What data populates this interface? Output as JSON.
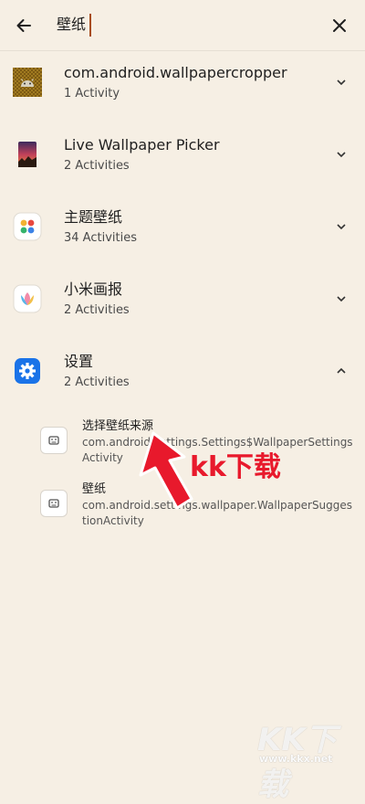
{
  "search": {
    "value": "壁纸",
    "back_icon": "arrow-left-icon",
    "clear_icon": "close-icon"
  },
  "results": [
    {
      "title": "com.android.wallpapercropper",
      "subtitle": "1 Activity",
      "icon": "android-robot-icon",
      "expanded": false
    },
    {
      "title": "Live Wallpaper Picker",
      "subtitle": "2 Activities",
      "icon": "live-wallpaper-icon",
      "expanded": false
    },
    {
      "title": "主题壁纸",
      "subtitle": "34 Activities",
      "icon": "theme-icon",
      "expanded": false
    },
    {
      "title": "小米画报",
      "subtitle": "2 Activities",
      "icon": "mi-pictorial-icon",
      "expanded": false
    },
    {
      "title": "设置",
      "subtitle": "2 Activities",
      "icon": "settings-gear-icon",
      "expanded": true
    }
  ],
  "activities": [
    {
      "title": "选择壁纸来源",
      "class_name": "com.android.settings.Settings$WallpaperSettingsActivity"
    },
    {
      "title": "壁纸",
      "class_name": "com.android.settings.wallpaper.WallpaperSuggestionActivity"
    }
  ],
  "overlay": {
    "annotation_text": "kk下载",
    "watermark_logo": "KK下载",
    "watermark_url": "www.kkx.net",
    "accent_color": "#e8192c"
  },
  "colors": {
    "background": "#f6efe4",
    "caret": "#a84d1c",
    "settings_icon": "#1a73e8"
  }
}
